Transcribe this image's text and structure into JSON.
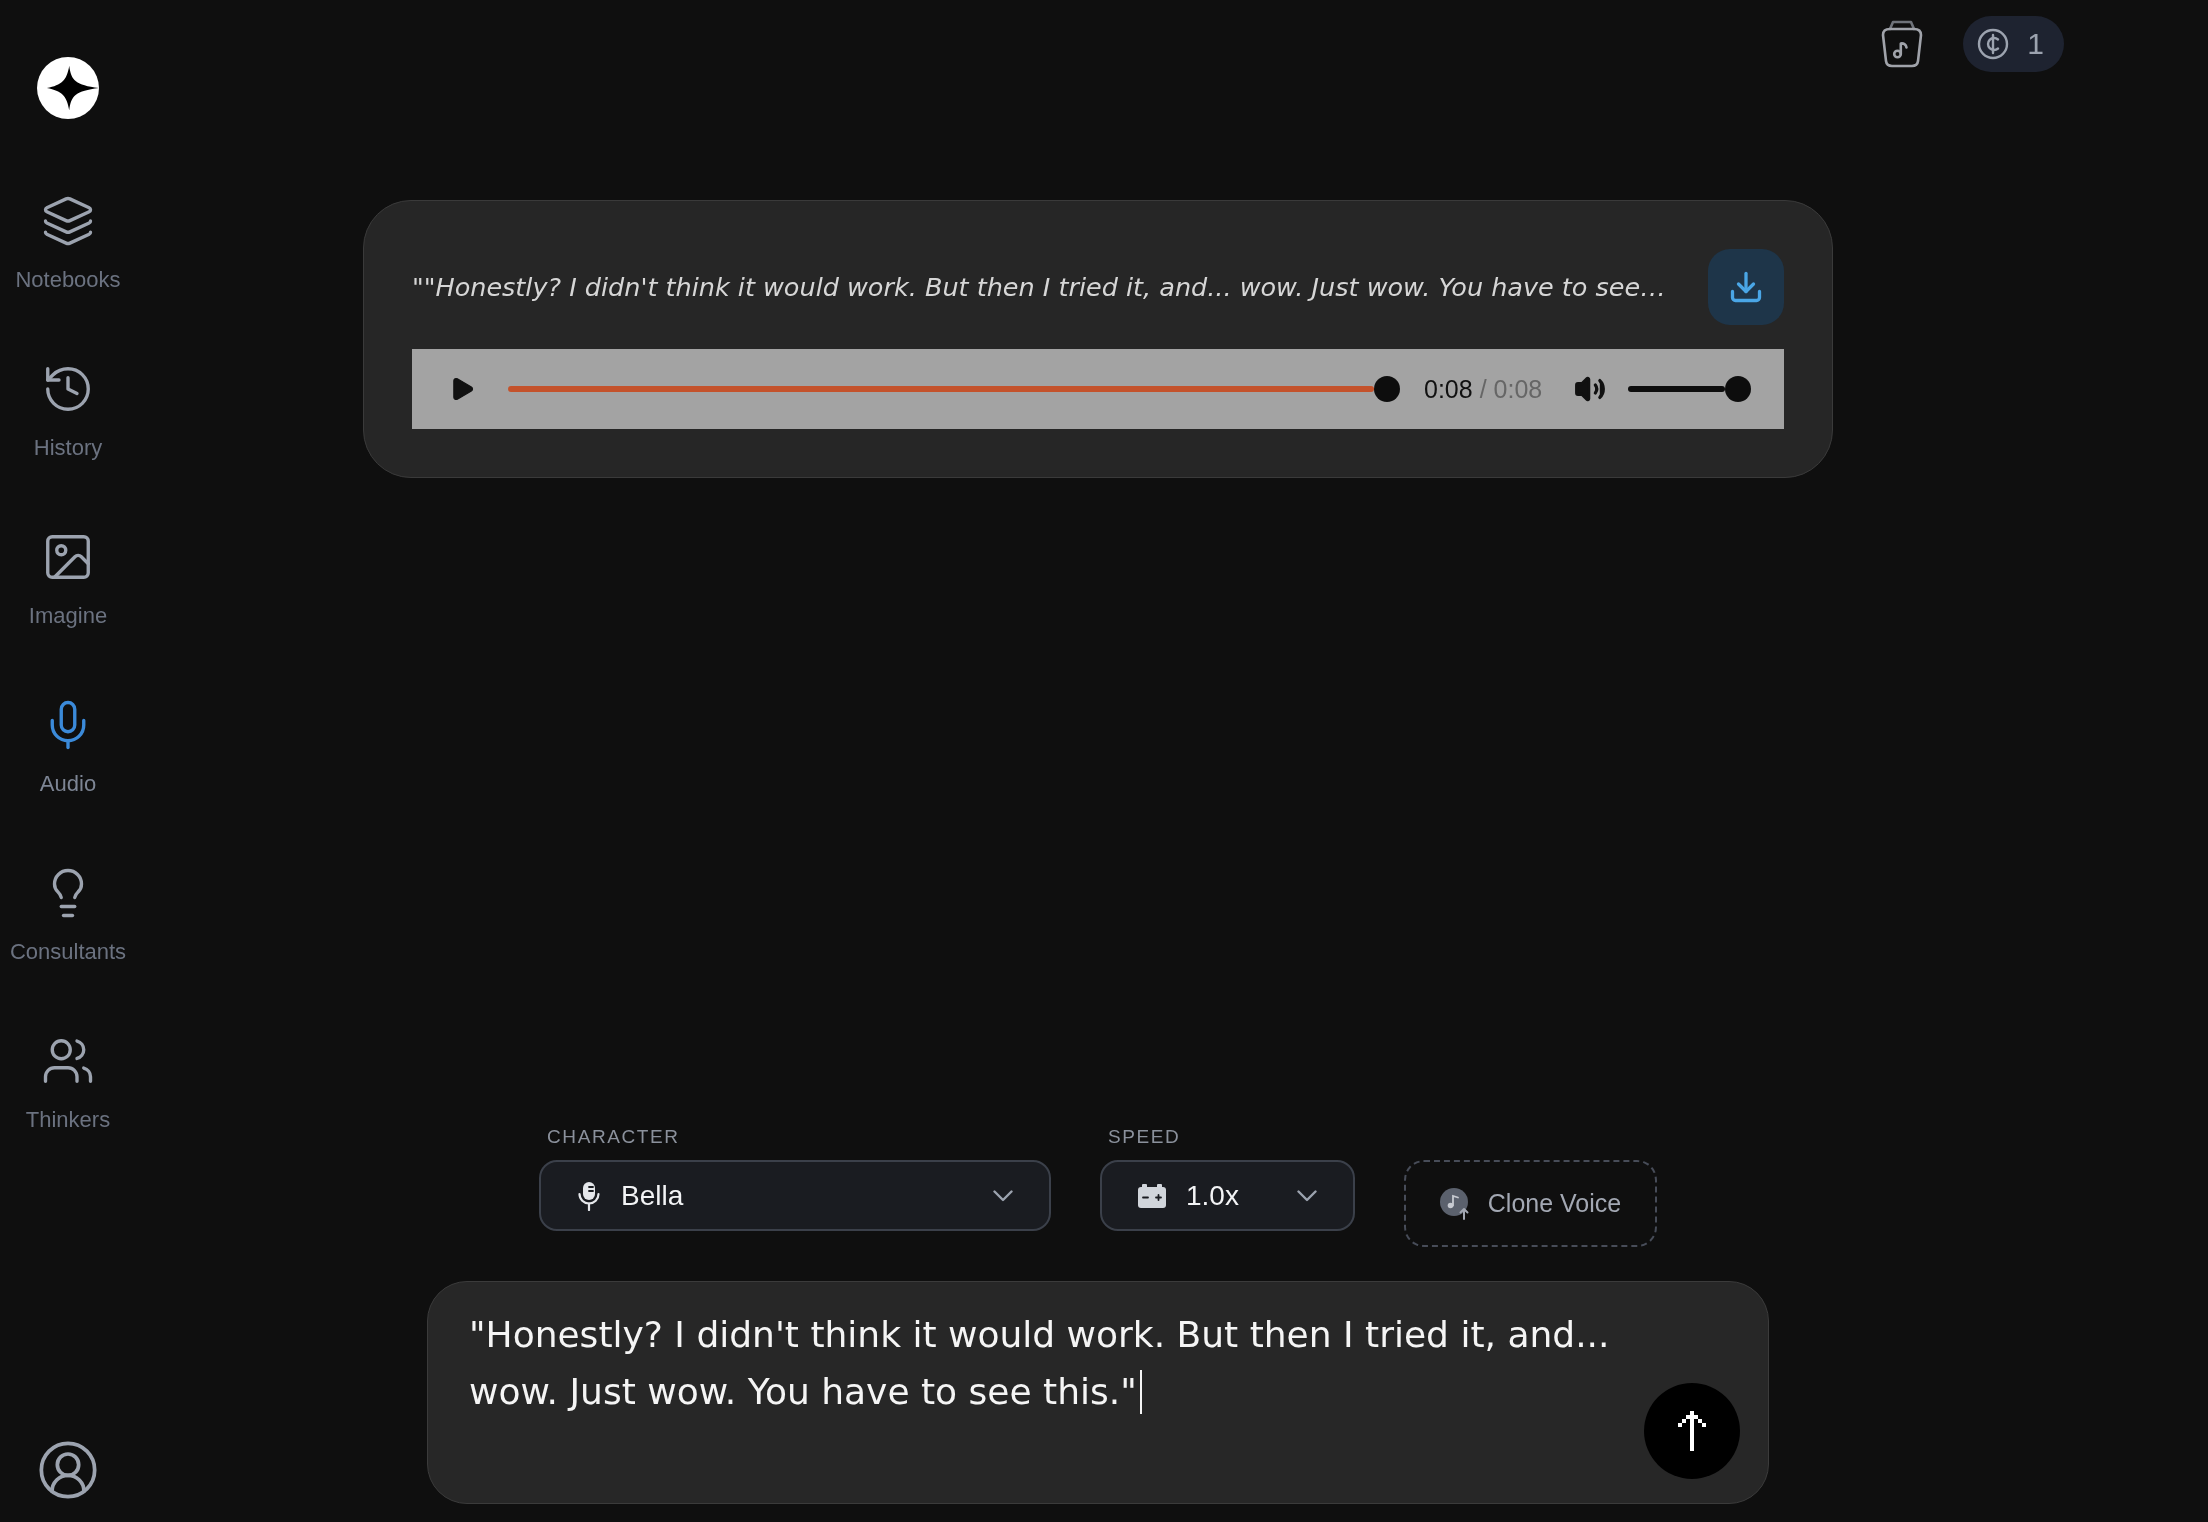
{
  "sidebar": {
    "items": [
      {
        "label": "Notebooks",
        "selected": false
      },
      {
        "label": "History",
        "selected": false
      },
      {
        "label": "Imagine",
        "selected": false
      },
      {
        "label": "Audio",
        "selected": true
      },
      {
        "label": "Consultants",
        "selected": false
      },
      {
        "label": "Thinkers",
        "selected": false
      }
    ]
  },
  "top_bar": {
    "credits": "1"
  },
  "audio_card": {
    "quote": "\"\"Honestly? I didn't think it would work. But then I tried it, and... wow. Just wow. You have to see…",
    "player": {
      "playing": false,
      "progress": {
        "level": 1
      },
      "current_time": "0:08",
      "duration": "/ 0:08",
      "volume": {
        "level": 1
      }
    }
  },
  "controls": {
    "character": {
      "label": "CHARACTER",
      "value": "Bella"
    },
    "speed": {
      "label": "SPEED",
      "value": "1.0x"
    },
    "clone_voice": {
      "label": "Clone Voice"
    }
  },
  "composer": {
    "value": "\"Honestly? I didn't think it would work. But then I tried it, and... wow. Just wow. You have to see this.\"",
    "focused": true
  }
}
